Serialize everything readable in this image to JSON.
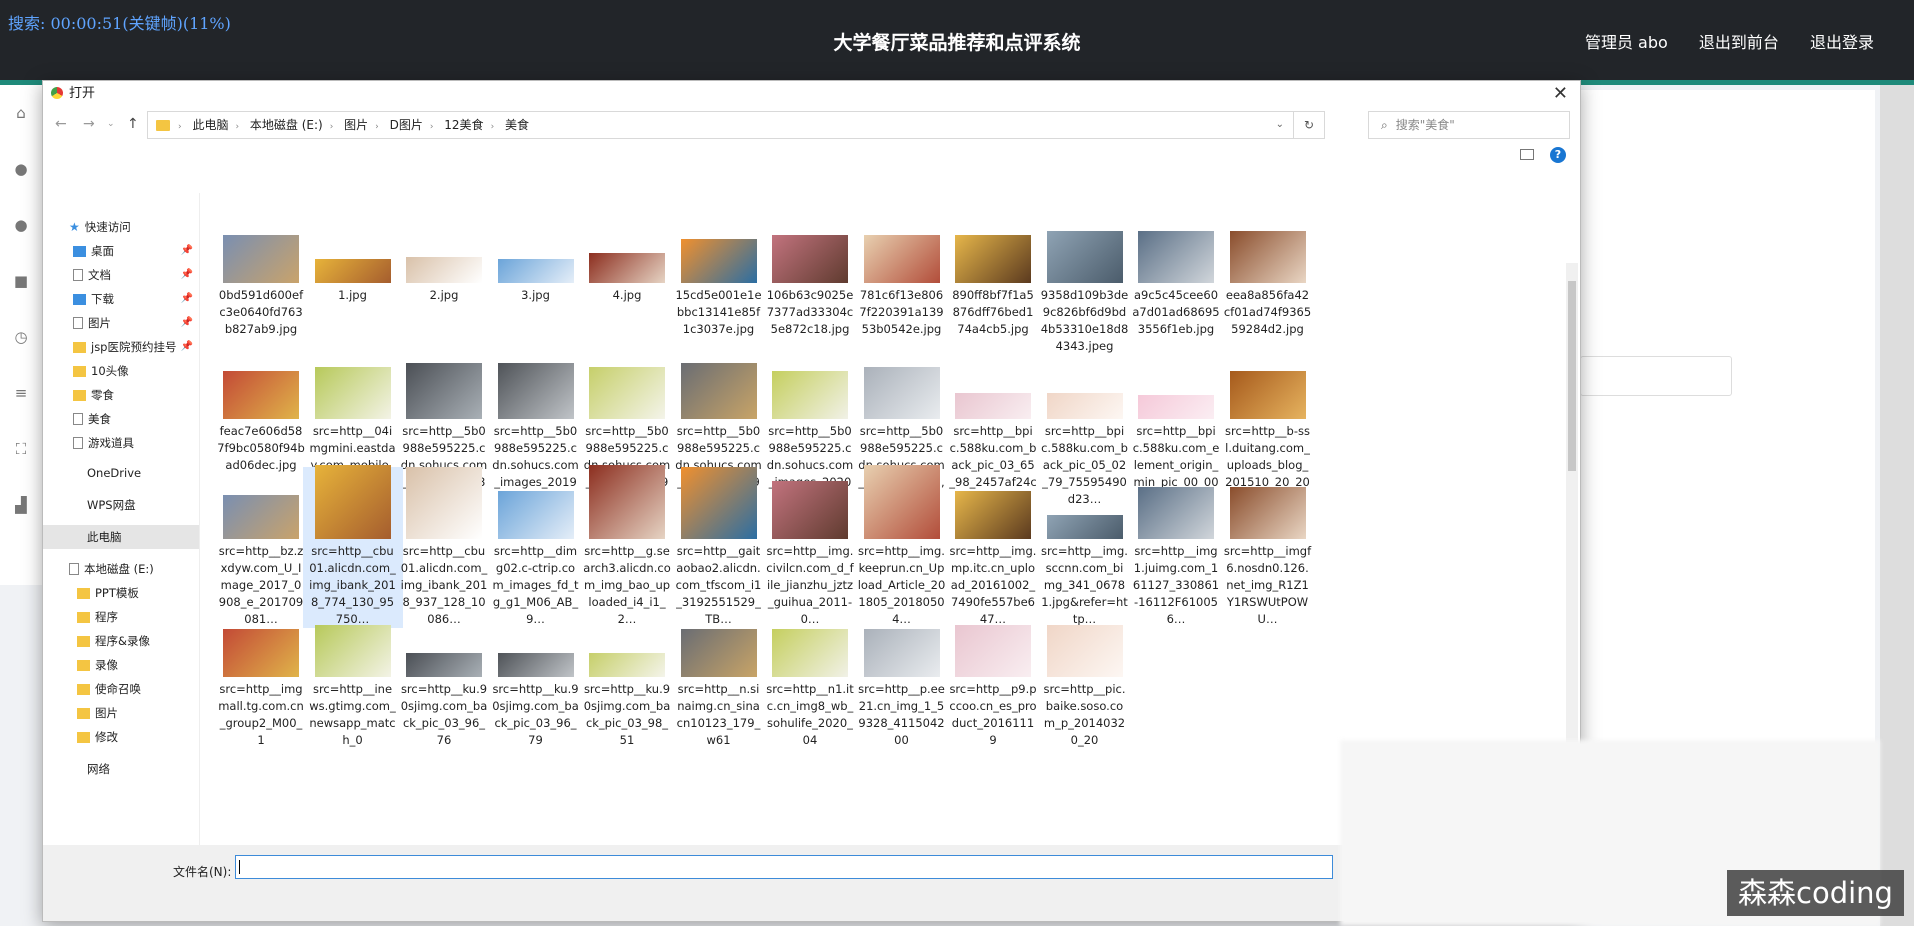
{
  "recorder_text": "搜索: 00:00:51(关键帧)(11%)",
  "app_title": "大学餐厅菜品推荐和点评系统",
  "user_menu": {
    "admin": "管理员 abo",
    "to_front": "退出到前台",
    "logout": "退出登录"
  },
  "dialog": {
    "title": "打开",
    "breadcrumb": [
      "此电脑",
      "本地磁盘 (E:)",
      "图片",
      "D图片",
      "12美食",
      "美食"
    ],
    "search_placeholder": "搜索\"美食\"",
    "filename_label": "文件名(N):",
    "filename_value": ""
  },
  "nav": {
    "quick_access": "快速访问",
    "items": [
      {
        "label": "桌面",
        "icon": "desktop-icon",
        "pinned": true
      },
      {
        "label": "文档",
        "icon": "document-icon",
        "pinned": true
      },
      {
        "label": "下载",
        "icon": "download-icon",
        "pinned": true
      },
      {
        "label": "图片",
        "icon": "pictures-icon",
        "pinned": true
      },
      {
        "label": "jsp医院预约挂号",
        "icon": "folder-icon",
        "pinned": true
      },
      {
        "label": "10头像",
        "icon": "folder-icon",
        "pinned": false
      },
      {
        "label": "零食",
        "icon": "folder-icon",
        "pinned": false
      },
      {
        "label": "美食",
        "icon": "file-icon",
        "pinned": false
      },
      {
        "label": "游戏道具",
        "icon": "file-icon",
        "pinned": false
      }
    ],
    "onedrive": "OneDrive",
    "wps": "WPS网盘",
    "this_pc": "此电脑",
    "local_disk": "本地磁盘 (E:)",
    "disk_items": [
      "PPT模板",
      "程序",
      "程序&录像",
      "录像",
      "使命召唤",
      "图片",
      "修改"
    ],
    "network": "网络"
  },
  "files": [
    [
      "0bd591d600efc3e0640fd763b827ab9.jpg",
      "1.jpg",
      "2.jpg",
      "3.jpg",
      "4.jpg",
      "15cd5e001e1ebbc13141e85f1c3037e.jpg",
      "106b63c9025e7377ad33304c5e872c18.jpg",
      "781c6f13e8067f220391a13953b0542e.jpg",
      "890ff8bf7f1a5876dff76bed174a4cb5.jpg",
      "9358d109b3de9c826bf6d9bd4b53310e18d84343.jpeg",
      "a9c5c45cee60a7d01ad686953556f1eb.jpg",
      "eea8a856fa42cf01ad74f936559284d2.jpg"
    ],
    [
      "feac7e606d587f9bc0580f94bad06dec.jpg",
      "src=http__04imgmini.eastday.com_mobile_20181021_201810…",
      "src=http__5b0988e595225.cdn.sohucs.com_images_20181…",
      "src=http__5b0988e595225.cdn.sohucs.com_images_20190…",
      "src=http__5b0988e595225.cdn.sohucs.com_images_20190…",
      "src=http__5b0988e595225.cdn.sohucs.com_images_20190…",
      "src=http__5b0988e595225.cdn.sohucs.com_images_20200…",
      "src=http__5b0988e595225.cdn.sohucs.com_q_70_c_zoom,w_…",
      "src=http__bpic.588ku.com_back_pic_03_65_98_2457af24c1b2…",
      "src=http__bpic.588ku.com_back_pic_05_02_79_75595490d23…",
      "src=http__bpic.588ku.com_element_origin_min_pic_00_00_0…",
      "src=http__b-ssl.duitang.com_uploads_blog_201510_20_2015…"
    ],
    [
      "src=http__bz.zxdyw.com_U_Image_2017_0908_e_201709081…",
      "src=http__cbu01.alicdn.com_img_ibank_2018_774_130_95750…",
      "src=http__cbu01.alicdn.com_img_ibank_2018_937_128_10086…",
      "src=http__dimg02.c-ctrip.com_images_fd_tg_g1_M06_AB_9…",
      "src=http__g.search3.alicdn.com_img_bao_uploaded_i4_i1_2…",
      "src=http__gaitaobao2.alicdn.com_tfscom_i1_3192551529_TB…",
      "src=http__img.civilcn.com_d_file_jianzhu_jztz_guihua_2011-0…",
      "src=http__img.keeprun.cn_Upload_Article_201805_20180504…",
      "src=http__img.mp.itc.cn_upload_20161002_7490fe557be647…",
      "src=http__img.sccnn.com_bimg_341_06781.jpg&refer=http…",
      "src=http__img1.juimg.com_161127_330861-16112F610056…",
      "src=http__imgf6.nosdn0.126.net_img_R1Z1Y1RSWUtPOWU…"
    ],
    [
      "src=http__img mall.tg.com.cn_group2_M00_1",
      "src=http__inews.gtimg.com_newsapp_match_0",
      "src=http__ku.90sjimg.com_back_pic_03_96_76",
      "src=http__ku.90sjimg.com_back_pic_03_96_79",
      "src=http__ku.90sjimg.com_back_pic_03_98_51",
      "src=http__n.sinaimg.cn_sinacn10123_179_w61",
      "src=http__n1.itc.cn_img8_wb_sohulife_2020_04",
      "src=http__p.ee21.cn_img_1_59328_411504200",
      "src=http__p9.pccoo.cn_es_product_20161119",
      "src=http__pic.baike.soso.com_p_20140320_20"
    ]
  ],
  "watermark": "森森coding"
}
